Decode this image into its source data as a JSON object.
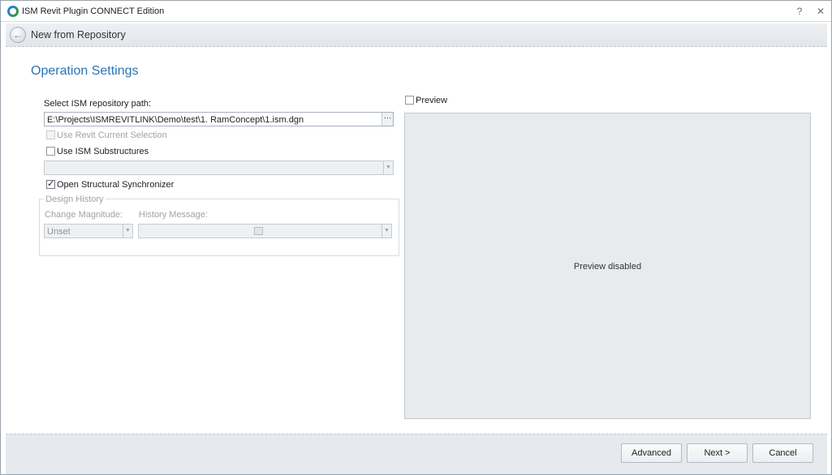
{
  "window": {
    "title": "ISM Revit Plugin CONNECT Edition",
    "help_glyph": "?",
    "close_glyph": "✕"
  },
  "header": {
    "back_glyph": "←",
    "title": "New from Repository"
  },
  "section": {
    "title": "Operation Settings"
  },
  "repository": {
    "label": "Select ISM repository path:",
    "path_value": "E:\\Projects\\ISMREVITLINK\\Demo\\test\\1. RamConcept\\1.ism.dgn",
    "browse_label": "···"
  },
  "options": {
    "use_revit_selection": {
      "label": "Use Revit Current Selection",
      "checked": false,
      "enabled": false
    },
    "use_ism_substructures": {
      "label": "Use ISM Substructures",
      "checked": false,
      "enabled": true
    },
    "substructure_combo_value": "",
    "open_structural_synchronizer": {
      "label": "Open Structural Synchronizer",
      "checked": true,
      "enabled": true
    }
  },
  "design_history": {
    "title": "Design History",
    "change_magnitude_label": "Change Magnitude:",
    "change_magnitude_value": "Unset",
    "history_message_label": "History Message:",
    "history_message_value": ""
  },
  "preview": {
    "checkbox_label": "Preview",
    "checked": false,
    "disabled_message": "Preview disabled"
  },
  "footer": {
    "advanced_label": "Advanced",
    "next_label": "Next >",
    "cancel_label": "Cancel"
  },
  "icons": {
    "app": "ism-logo-icon",
    "help": "help-icon",
    "close": "close-icon",
    "back": "back-arrow-icon",
    "browse": "ellipsis-icon",
    "dropdown": "chevron-down-icon"
  },
  "colors": {
    "accent_title": "#2b74b5",
    "disabled_text": "#9ea3a8",
    "preview_bg": "#e8ebee",
    "header_bg": "#e2e6ea"
  }
}
